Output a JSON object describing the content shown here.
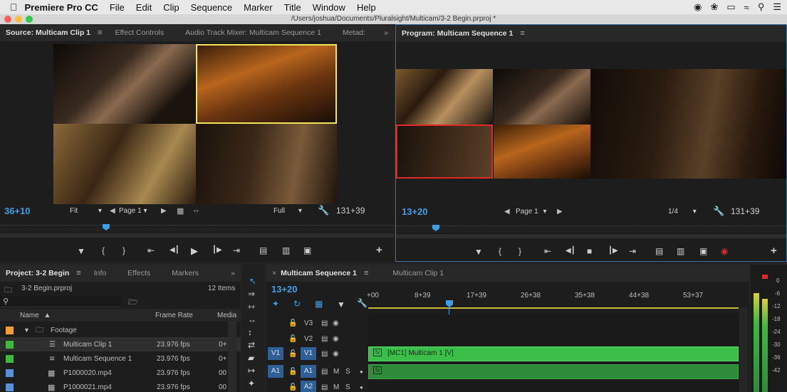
{
  "menubar": {
    "app_name": "Premiere Pro CC",
    "items": [
      "File",
      "Edit",
      "Clip",
      "Sequence",
      "Marker",
      "Title",
      "Window",
      "Help"
    ]
  },
  "window": {
    "path": "/Users/joshua/Documents/Pluralsight/Multicam/3-2 Begin.prproj *"
  },
  "source": {
    "tabs": [
      "Source: Multicam Clip 1",
      "Effect Controls",
      "Audio Track Mixer: Multicam Sequence 1",
      "Metad:"
    ],
    "timecode": "36+10",
    "fit": "Fit",
    "page": "Page 1",
    "quality": "Full",
    "duration": "131+39"
  },
  "program": {
    "tab": "Program: Multicam Sequence 1",
    "timecode": "13+20",
    "page": "Page 1",
    "fraction": "1/4",
    "duration": "131+39"
  },
  "project": {
    "tabs": [
      "Project: 3-2 Begin",
      "Info",
      "Effects",
      "Markers"
    ],
    "filename": "3-2 Begin.prproj",
    "item_count": "12 Items",
    "columns": {
      "name": "Name",
      "frame_rate": "Frame Rate",
      "media": "Media"
    },
    "rows": [
      {
        "name": "Footage",
        "rate": "",
        "media": "",
        "color": "#f0a030"
      },
      {
        "name": "Multicam Clip 1",
        "rate": "23.976 fps",
        "media": "0+",
        "color": "#3fb83f"
      },
      {
        "name": "Multicam Sequence 1",
        "rate": "23.976 fps",
        "media": "0+",
        "color": "#3fb83f"
      },
      {
        "name": "P1000020.mp4",
        "rate": "23.976 fps",
        "media": "00",
        "color": "#5b8fd6"
      },
      {
        "name": "P1000021.mp4",
        "rate": "23.976 fps",
        "media": "00",
        "color": "#5b8fd6"
      }
    ]
  },
  "timeline": {
    "tabs": [
      "Multicam Sequence 1",
      "Multicam Clip 1"
    ],
    "timecode": "13+20",
    "ruler": [
      "+00",
      "8+39",
      "17+39",
      "26+38",
      "35+38",
      "44+38",
      "53+37"
    ],
    "tracks": [
      {
        "target": "",
        "name": "V3"
      },
      {
        "target": "",
        "name": "V2"
      },
      {
        "target": "V1",
        "name": "V1"
      },
      {
        "target": "A1",
        "name": "A1",
        "m": "M",
        "s": "S"
      },
      {
        "target": "",
        "name": "A2",
        "m": "M",
        "s": "S"
      }
    ],
    "clip_video": "[MC1] Multicam 1 [V]",
    "clip_badge": "fx"
  },
  "meter": {
    "scale": [
      "0",
      "-6",
      "-12",
      "-18",
      "-24",
      "-30",
      "-36",
      "-42"
    ]
  }
}
